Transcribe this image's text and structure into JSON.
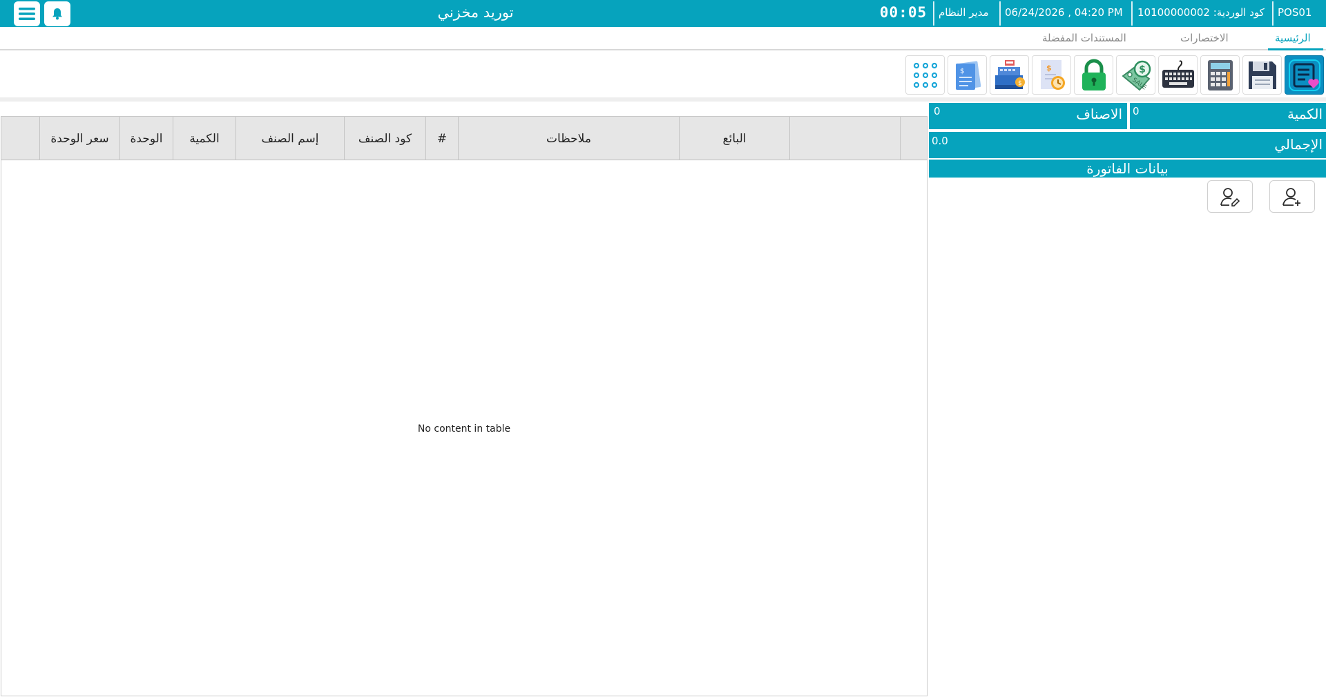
{
  "app": {
    "pos_id": "POS01",
    "shift_code": "كود الوردية: 10100000002",
    "datetime": "06/24/2026 , 04:20 PM",
    "user": "مدير النظام",
    "timer": "00:05",
    "page_title": "توريد مخزني",
    "brand_color": "#06a3bd"
  },
  "tabs": [
    {
      "label": "الرئيسية",
      "active": true
    },
    {
      "label": "الاختصارات",
      "active": false
    },
    {
      "label": "المستندات المفضلة",
      "active": false
    }
  ],
  "toolbar": {
    "icons": [
      "favorites-list-icon",
      "save-icon",
      "calculator-icon",
      "keyboard-icon",
      "sale-tag-icon",
      "lock-icon",
      "receipt-clock-icon",
      "cash-register-icon",
      "document-icon",
      "numpad-icon"
    ]
  },
  "grid": {
    "columns": [
      "سعر الوحدة",
      "الوحدة",
      "الكمية",
      "إسم الصنف",
      "كود الصنف",
      "#",
      "ملاحظات",
      "البائع",
      "",
      ""
    ],
    "empty_message": "No content in table"
  },
  "summary": {
    "quantity_label": "الكمية",
    "quantity_value": "0",
    "items_label": "الاصناف",
    "items_value": "0",
    "total_label": "الإجمالي",
    "total_value": "0.0",
    "invoice_header": "بيانات الفاتورة"
  }
}
